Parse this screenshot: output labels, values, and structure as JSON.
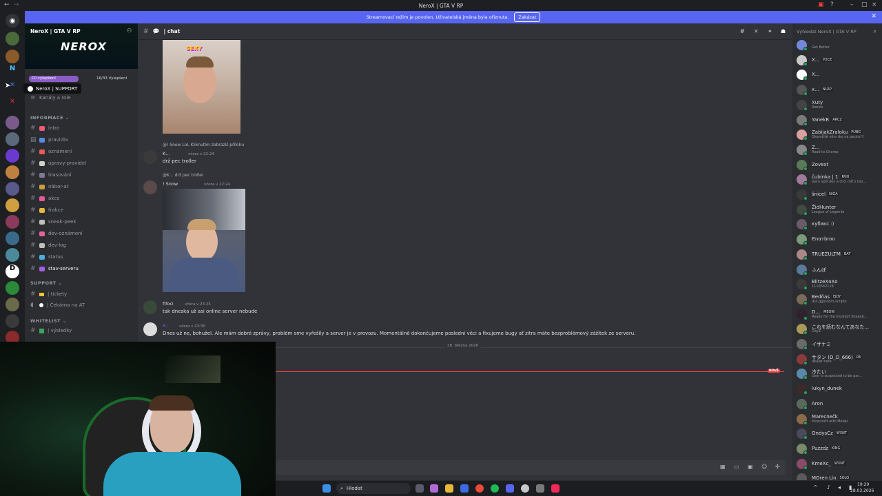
{
  "window": {
    "title": "NeroX | GTA V RP"
  },
  "banner": {
    "message": "Streamovací režim je povolen. Uživatelská jména byla ořiznuta.",
    "button": "Zakázat"
  },
  "server": {
    "name": "NeroX | GTA V RP",
    "logo_text": "NEROX",
    "boost_goal": "Cíl vylepšení",
    "boost_count": "16/33 Vylepšení",
    "tooltip": "NeroX | SUPPORT",
    "channels_roles": "Kanály a role"
  },
  "categories": {
    "informace": "INFORMACE",
    "support": "SUPPORT",
    "whitelist": "WHITELIST"
  },
  "channels": {
    "informace": [
      "intro",
      "pravidla",
      "oznámení",
      "úpravy-pravidel",
      "hlasování",
      "nábor-at",
      "akce",
      "frakce",
      "sneak-peek",
      "dev-oznámení",
      "dev-log",
      "status",
      "stav-serveru"
    ],
    "support": [
      "| tickety",
      "| Čekárna na AT"
    ],
    "whitelist": [
      "| výsledky"
    ]
  },
  "chat": {
    "channel": "| chat",
    "sticker_text": "SEXY",
    "msg1": {
      "reply": "@! Snow LoL  Kliknutím zobrazíš přílohu",
      "user": "K...",
      "time": "včera v 22:24",
      "text": "drž pec troller"
    },
    "msg2": {
      "reply": "@K...  drž pec troller",
      "user": "! Snow",
      "badge": "LoL",
      "time": "včera v 22:24"
    },
    "msg3": {
      "user": "fifoci",
      "time": "včera v 23:25",
      "text": "tak dneska už asi online server nebude"
    },
    "msg4": {
      "user": "R...",
      "time": "včera v 23:30",
      "text": "Dnes už ne, bohužel. Ale mám dobré zprávy, problém sme vyřešily a server je v provozu. Momentálně dokončujeme poslední věci a fixujeme bugy ať zitra máte bezproblémový zážitek ze serveru."
    },
    "date_divider": "28. března 2026",
    "new_label": "NOVÉ"
  },
  "members_search": "Vyhledat NeroX | GTA V RP",
  "members": [
    {
      "name": "",
      "status": "Get Better",
      "color": "#7289da"
    },
    {
      "name": "X...",
      "tag": "P2CE",
      "color": "#c9c9c9"
    },
    {
      "name": "X...",
      "tag": "",
      "color": "#ffffff"
    },
    {
      "name": "x...",
      "tag": "NLRP",
      "color": "#555555"
    },
    {
      "name": "Xuty",
      "status": "Roblox",
      "color": "#444444"
    },
    {
      "name": "YanekR",
      "tag": "ARCZ",
      "color": "#7a7a7a"
    },
    {
      "name": "ZabijakZraloku",
      "tag": "PUBG",
      "status": "Okamžitě něm dej na pecku!!!",
      "color": "#d9a0a0"
    },
    {
      "name": "Z...",
      "status": "Road to Champ",
      "color": "#888888"
    },
    {
      "name": "Zovext",
      "tag": "",
      "color": "#5a7a5a"
    },
    {
      "name": "čubinka | 1",
      "tag": "RVN",
      "status": "Jsem spíš dex a chci míť s teb...",
      "color": "#a07a9a"
    },
    {
      "name": "šnicel",
      "tag": "NIGA",
      "color": "#3a3a3a"
    },
    {
      "name": "ŽidHunter",
      "status": "League of Legends",
      "color": "#404a40"
    },
    {
      "name": "кубакс :)",
      "tag": "",
      "color": "#6a5a6a"
    },
    {
      "name": "Єnαтbroo",
      "tag": "",
      "color": "#7a9a7a"
    },
    {
      "name": "TRUEZULTM",
      "tag": "BAT",
      "color": "#aa8888"
    },
    {
      "name": "ふんぽ",
      "tag": "",
      "color": "#5a7a9a"
    },
    {
      "name": "BlitzeXoXo",
      "status": "1119542118",
      "color": "#3a3a3a"
    },
    {
      "name": "Bedňas",
      "tag": "EJOY",
      "status": "dsc.gg/noom-scripts",
      "color": "#7a6a5a"
    },
    {
      "name": "D...",
      "tag": "MEOW",
      "status": "Ready for the moshpit Shakab...",
      "color": "#302030"
    },
    {
      "name": "これを読むなんてあなた...",
      "status": "DayZ",
      "color": "#aa9a5a"
    },
    {
      "name": "イザナミ",
      "tag": "",
      "color": "#6a6a6a"
    },
    {
      "name": "サタン (D_D_666)",
      "tag": "R6",
      "status": "dealer here",
      "color": "#8a3a3a"
    },
    {
      "name": "冷たい",
      "status": "User is suspected to be par...",
      "color": "#5a8aaa"
    },
    {
      "name": "lukyn_dunek",
      "tag": "",
      "color": "#3a2a2a"
    },
    {
      "name": "Aron",
      "tag": "",
      "color": "#5a6a5a"
    },
    {
      "name": "Marecnečk",
      "status": "Minecraft with Medal",
      "color": "#8a6a4a"
    },
    {
      "name": "OndysCz",
      "tag": "WXNT",
      "color": "#4a4a5a"
    },
    {
      "name": "Puzzdz",
      "tag": "KING",
      "color": "#7a8a6a"
    },
    {
      "name": "KmeXc_",
      "tag": "WXNT",
      "color": "#8a4a6a"
    },
    {
      "name": "MOren Lin",
      "tag": "SOLO",
      "color": "#5a5a5a"
    }
  ],
  "taskbar": {
    "search": "Hledat",
    "time": "19:20",
    "date": "28.03.2026"
  }
}
